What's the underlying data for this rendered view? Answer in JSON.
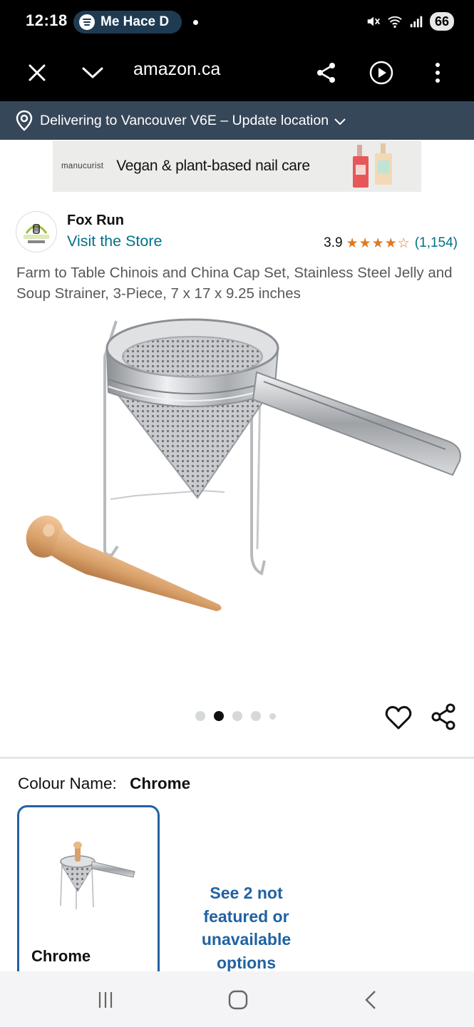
{
  "status_bar": {
    "time": "12:18",
    "media_text": "Me Hace D",
    "battery": "66"
  },
  "browser": {
    "url": "amazon.ca"
  },
  "delivery": {
    "text": "Delivering to Vancouver V6E – Update location"
  },
  "ad": {
    "brand": "manucurist",
    "title": "Vegan & plant-based nail care"
  },
  "brand": {
    "name": "Fox Run",
    "visit_store": "Visit the Store",
    "logo_text": "FOX RUN BRANDS"
  },
  "rating": {
    "value": "3.9",
    "stars": 3.9,
    "count": "(1,154)"
  },
  "product": {
    "title": "Farm to Table Chinois and China Cap Set, Stainless Steel Jelly and Soup Strainer, 3-Piece, 7 x 17 x 9.25 inches"
  },
  "carousel": {
    "total": 5,
    "active_index": 1
  },
  "colour": {
    "label": "Colour Name:",
    "value": "Chrome",
    "swatch_label": "Chrome",
    "see_more": "See 2 not featured or unavailable options"
  },
  "colors": {
    "link": "#007185",
    "star": "#de7921",
    "delivery_bg": "#37475a",
    "swatch_border": "#2162a1"
  },
  "icons": {
    "close": "close-icon",
    "collapse": "chevron-down-icon",
    "share": "share-icon",
    "play": "play-icon",
    "menu": "more-vert-icon",
    "location": "location-pin-icon",
    "wishlist": "heart-icon",
    "nav_recents": "recents-icon",
    "nav_home": "home-icon",
    "nav_back": "back-icon"
  }
}
